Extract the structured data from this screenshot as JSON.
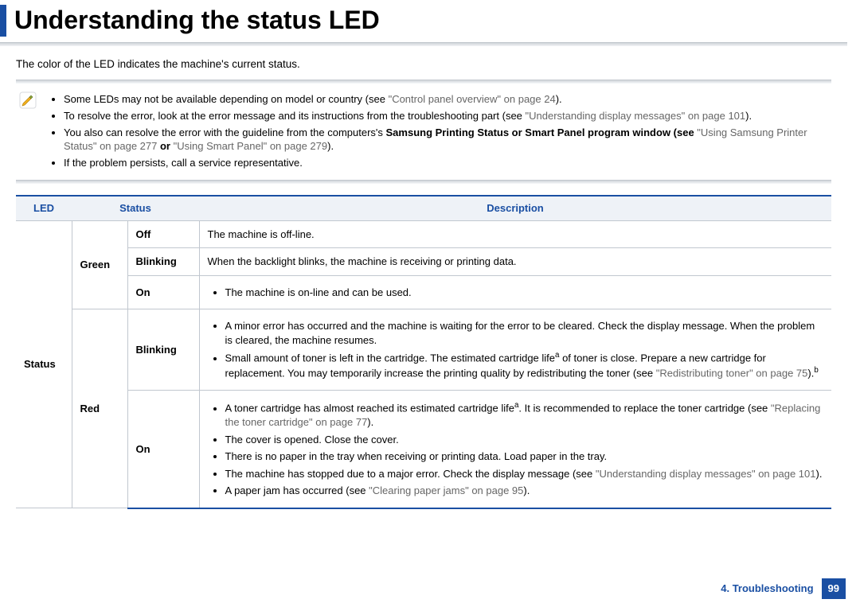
{
  "header": {
    "title": "Understanding the status LED"
  },
  "intro": "The color of the LED indicates the machine's current status.",
  "notes": {
    "items": [
      {
        "pre": "Some LEDs may not be available depending on model or country (see ",
        "xref": "\"Control panel overview\" on page 24",
        "post": ")."
      },
      {
        "pre": "To resolve the error, look at the error message and its instructions from the troubleshooting part (see ",
        "xref": "\"Understanding display messages\" on page 101",
        "post": ")."
      },
      {
        "pre": "You also can resolve the error with the guideline from the computers's ",
        "bold": "Samsung Printing Status or Smart Panel program window (see ",
        "xref": "\"Using Samsung Printer Status\" on page 277",
        "mid": " or ",
        "xref2": "\"Using Smart Panel\" on page 279",
        "post": ")."
      },
      {
        "pre": "If the problem persists, call a service representative.",
        "xref": "",
        "post": ""
      }
    ]
  },
  "table": {
    "headers": {
      "led": "LED",
      "status": "Status",
      "desc": "Description"
    },
    "ledLabel": "Status",
    "green": {
      "label": "Green",
      "off": {
        "s": "Off",
        "d": "The machine is off-line."
      },
      "blink": {
        "s": "Blinking",
        "d": "When the backlight blinks, the machine is receiving or printing data."
      },
      "on": {
        "s": "On",
        "d": "The machine is on-line and can be used."
      }
    },
    "red": {
      "label": "Red",
      "blink": {
        "s": "Blinking",
        "d1": "A minor error has occurred and the machine is waiting for the error to be cleared. Check the display message. When the problem is cleared, the machine resumes.",
        "d2a": "Small amount of toner is left in the cartridge. The estimated cartridge life",
        "d2sup1": "a",
        "d2b": " of toner is close. Prepare a new cartridge for replacement. You may temporarily increase the printing quality by redistributing the toner (see ",
        "d2xref": "\"Redistributing toner\" on page 75",
        "d2c": ").",
        "d2sup2": "b"
      },
      "on": {
        "s": "On",
        "d1a": "A toner cartridge has almost reached its estimated cartridge life",
        "d1sup": "a",
        "d1b": ". It is recommended to replace the toner cartridge (see ",
        "d1xref": "\"Replacing the toner cartridge\" on page 77",
        "d1c": ").",
        "d2": "The cover is opened. Close the cover.",
        "d3": "There is no paper in the tray when receiving or printing data. Load paper in the tray.",
        "d4a": "The machine has stopped due to a major error. Check the display message (see ",
        "d4xref": "\"Understanding display messages\" on page 101",
        "d4b": ").",
        "d5a": "A paper jam has occurred (see ",
        "d5xref": "\"Clearing paper jams\" on page 95",
        "d5b": ")."
      }
    }
  },
  "footer": {
    "chapter": "4.  Troubleshooting",
    "page": "99"
  }
}
